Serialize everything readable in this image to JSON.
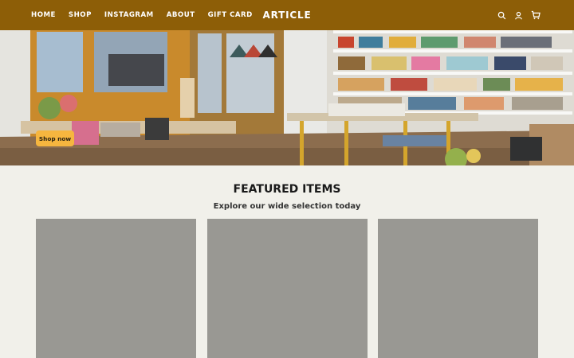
{
  "header": {
    "nav": [
      "HOME",
      "SHOP",
      "INSTAGRAM",
      "ABOUT",
      "GIFT CARD"
    ],
    "logo": "ARTICLE",
    "icons": [
      "search-icon",
      "account-icon",
      "cart-icon"
    ]
  },
  "hero": {
    "button_label": "Shop now"
  },
  "featured": {
    "title": "FEATURED ITEMS",
    "subtitle": "Explore our wide selection today",
    "cards": [
      {},
      {},
      {}
    ]
  },
  "colors": {
    "header": "#8d5e07",
    "button": "#f6b63f",
    "background": "#f1f0ea",
    "card": "#999893"
  }
}
